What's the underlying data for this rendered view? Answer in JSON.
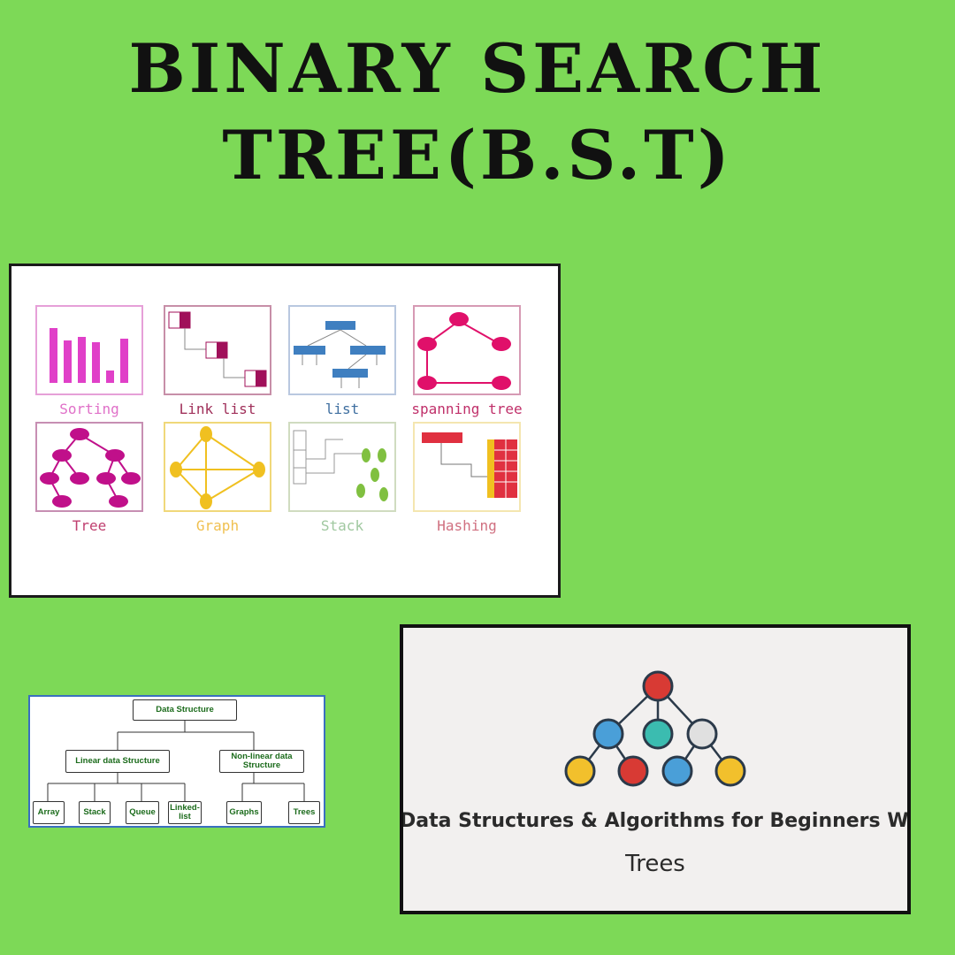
{
  "heading": {
    "line1": "BINARY SEARCH",
    "line2": "TREE(B.S.T)"
  },
  "ds_grid": {
    "tiles": [
      {
        "label": "Sorting",
        "color": "#e040c8"
      },
      {
        "label": "Link list",
        "color": "#a0105a"
      },
      {
        "label": "list",
        "color": "#3f7fc0"
      },
      {
        "label": "spanning tree",
        "color": "#e0106a"
      },
      {
        "label": "Tree",
        "color": "#c0108a"
      },
      {
        "label": "Graph",
        "color": "#f0c020"
      },
      {
        "label": "Stack",
        "color": "#80c040"
      },
      {
        "label": "Hashing",
        "color": "#e03040"
      }
    ]
  },
  "hierarchy": {
    "root": "Data Structure",
    "linear": "Linear data Structure",
    "nonlinear": "Non-linear data Structure",
    "leaves": [
      "Array",
      "Stack",
      "Queue",
      "Linked-list",
      "Graphs",
      "Trees"
    ]
  },
  "course": {
    "title": "Data Structures & Algorithms for Beginners W",
    "subtitle": "Trees"
  },
  "colors": {
    "background": "#7dd957"
  }
}
